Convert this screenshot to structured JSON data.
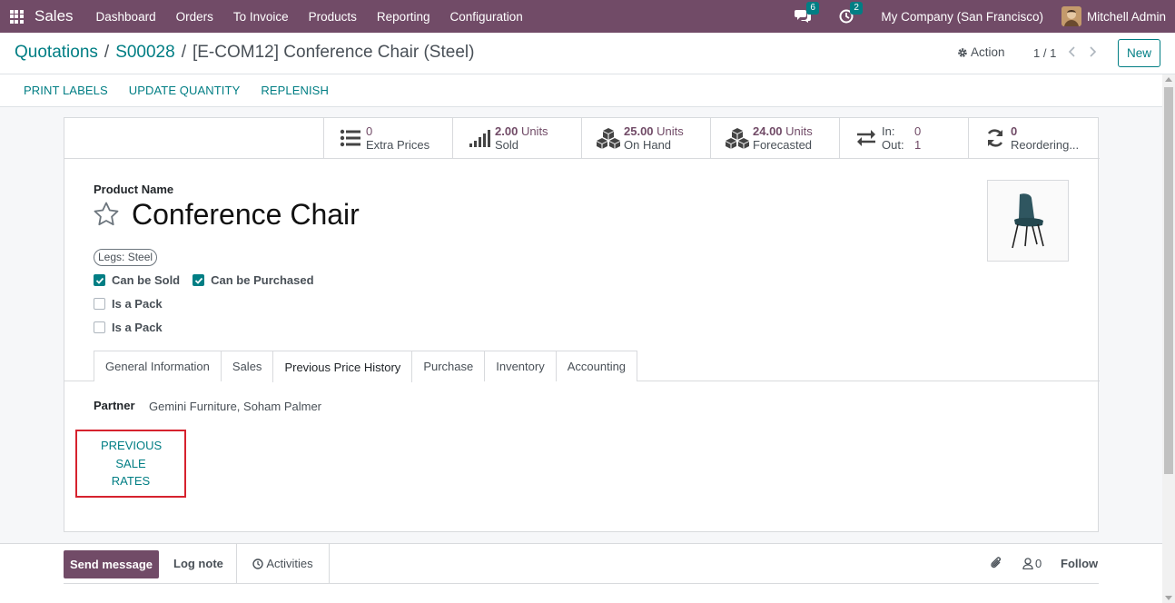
{
  "navbar": {
    "app_name": "Sales",
    "menu": [
      "Dashboard",
      "Orders",
      "To Invoice",
      "Products",
      "Reporting",
      "Configuration"
    ],
    "messages_badge": "6",
    "activities_badge": "2",
    "company": "My Company (San Francisco)",
    "user": "Mitchell Admin",
    "accent_color": "#714b67"
  },
  "breadcrumb": {
    "items": [
      "Quotations",
      "S00028"
    ],
    "separator": "/",
    "current": "[E-COM12] Conference Chair (Steel)"
  },
  "control": {
    "action_label": "Action",
    "pager": "1 / 1",
    "new_label": "New"
  },
  "statusbar": {
    "buttons": [
      "PRINT LABELS",
      "UPDATE QUANTITY",
      "REPLENISH"
    ]
  },
  "smart_buttons": {
    "extra_prices": {
      "value": "0",
      "label": "Extra Prices",
      "icon": "list-icon"
    },
    "sold": {
      "value": "2.00",
      "unit": "Units",
      "label": "Sold",
      "icon": "signal-bars-icon"
    },
    "on_hand": {
      "value": "25.00",
      "unit": "Units",
      "label": "On Hand",
      "icon": "cubes-icon"
    },
    "forecasted": {
      "value": "24.00",
      "unit": "Units",
      "label": "Forecasted",
      "icon": "cubes-icon"
    },
    "in_out": {
      "in_label": "In:",
      "in_value": "0",
      "out_label": "Out:",
      "out_value": "1",
      "icon": "exchange-arrows-icon"
    },
    "reordering": {
      "value": "0",
      "label": "Reordering...",
      "icon": "refresh-icon"
    }
  },
  "product": {
    "name_label": "Product Name",
    "name": "Conference Chair",
    "attribute_tag": "Legs: Steel",
    "can_be_sold_label": "Can be Sold",
    "can_be_sold": true,
    "can_be_purchased_label": "Can be Purchased",
    "can_be_purchased": true,
    "is_pack_label_1": "Is a Pack",
    "is_pack_label_2": "Is a Pack"
  },
  "tabs": {
    "items": [
      "General Information",
      "Sales",
      "Previous Price History",
      "Purchase",
      "Inventory",
      "Accounting"
    ],
    "active": "Previous Price History"
  },
  "price_history": {
    "partner_label": "Partner",
    "partner_value": "Gemini Furniture, Soham Palmer",
    "button_label": "PREVIOUS SALE RATES",
    "highlight_color": "#d6222e"
  },
  "chatter": {
    "send_message": "Send message",
    "log_note": "Log note",
    "activities": "Activities",
    "followers_count": "0",
    "follow": "Follow"
  }
}
